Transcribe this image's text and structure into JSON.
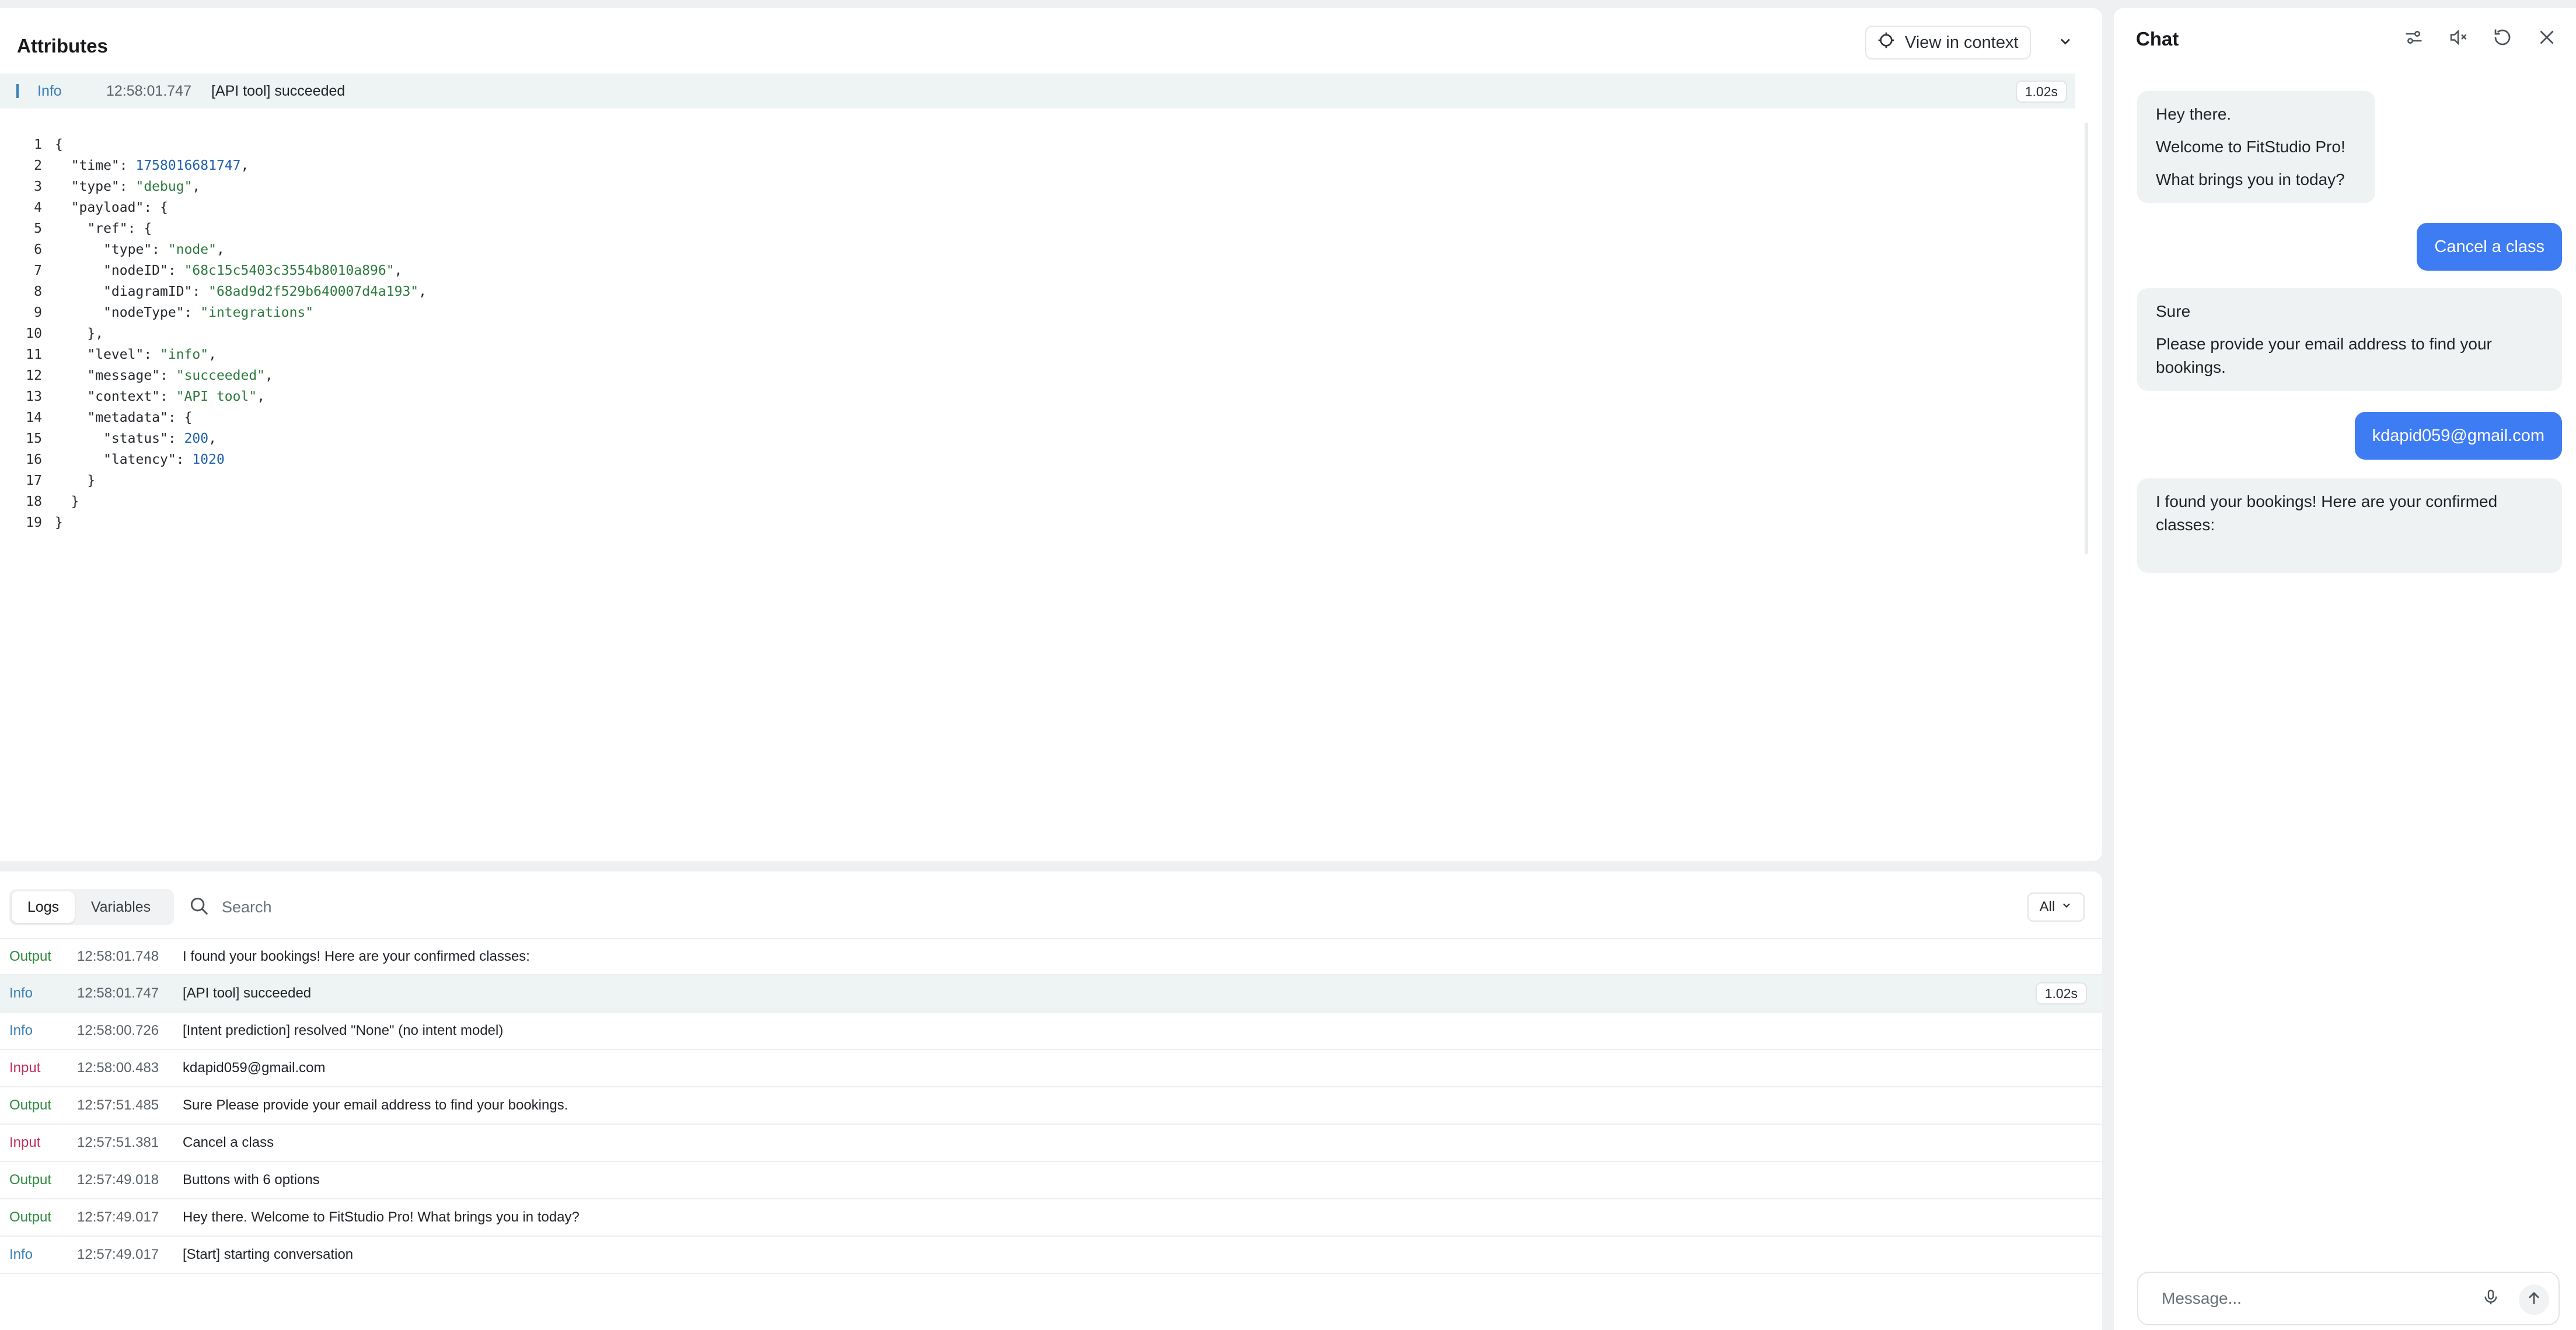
{
  "attributes": {
    "title": "Attributes",
    "view_in_context_label": "View in context",
    "selected_log": {
      "level": "Info",
      "timestamp": "12:58:01.747",
      "message": "[API tool] succeeded",
      "duration": "1.02s"
    },
    "code_lines": [
      {
        "n": "1",
        "t": "{"
      },
      {
        "n": "2",
        "t": "  \"time\": 1758016681747,"
      },
      {
        "n": "3",
        "t": "  \"type\": \"debug\","
      },
      {
        "n": "4",
        "t": "  \"payload\": {"
      },
      {
        "n": "5",
        "t": "    \"ref\": {"
      },
      {
        "n": "6",
        "t": "      \"type\": \"node\","
      },
      {
        "n": "7",
        "t": "      \"nodeID\": \"68c15c5403c3554b8010a896\","
      },
      {
        "n": "8",
        "t": "      \"diagramID\": \"68ad9d2f529b640007d4a193\","
      },
      {
        "n": "9",
        "t": "      \"nodeType\": \"integrations\""
      },
      {
        "n": "10",
        "t": "    },"
      },
      {
        "n": "11",
        "t": "    \"level\": \"info\","
      },
      {
        "n": "12",
        "t": "    \"message\": \"succeeded\","
      },
      {
        "n": "13",
        "t": "    \"context\": \"API tool\","
      },
      {
        "n": "14",
        "t": "    \"metadata\": {"
      },
      {
        "n": "15",
        "t": "      \"status\": 200,"
      },
      {
        "n": "16",
        "t": "      \"latency\": 1020"
      },
      {
        "n": "17",
        "t": "    }"
      },
      {
        "n": "18",
        "t": "  }"
      },
      {
        "n": "19",
        "t": "}"
      }
    ]
  },
  "logs": {
    "tabs": [
      {
        "label": "Logs",
        "active": true
      },
      {
        "label": "Variables",
        "active": false
      }
    ],
    "search_placeholder": "Search",
    "filter_label": "All",
    "rows": [
      {
        "level": "Output",
        "timestamp": "12:58:01.748",
        "message": "I found your bookings! Here are your confirmed classes:",
        "duration": "",
        "selected": false
      },
      {
        "level": "Info",
        "timestamp": "12:58:01.747",
        "message": "[API tool] succeeded",
        "duration": "1.02s",
        "selected": true
      },
      {
        "level": "Info",
        "timestamp": "12:58:00.726",
        "message": "[Intent prediction] resolved \"None\" (no intent model)",
        "duration": "",
        "selected": false
      },
      {
        "level": "Input",
        "timestamp": "12:58:00.483",
        "message": "kdapid059@gmail.com",
        "duration": "",
        "selected": false
      },
      {
        "level": "Output",
        "timestamp": "12:57:51.485",
        "message": "Sure Please provide your email address to find your bookings.",
        "duration": "",
        "selected": false
      },
      {
        "level": "Input",
        "timestamp": "12:57:51.381",
        "message": "Cancel a class",
        "duration": "",
        "selected": false
      },
      {
        "level": "Output",
        "timestamp": "12:57:49.018",
        "message": "Buttons with 6 options",
        "duration": "",
        "selected": false
      },
      {
        "level": "Output",
        "timestamp": "12:57:49.017",
        "message": "Hey there. Welcome to FitStudio Pro! What brings you in today?",
        "duration": "",
        "selected": false
      },
      {
        "level": "Info",
        "timestamp": "12:57:49.017",
        "message": "[Start] starting conversation",
        "duration": "",
        "selected": false
      }
    ]
  },
  "chat": {
    "title": "Chat",
    "icons": [
      "settings-sliders-icon",
      "mute-icon",
      "restart-icon",
      "close-icon"
    ],
    "messages": [
      {
        "from": "bot",
        "lines": [
          "Hey there.",
          "Welcome to FitStudio Pro!",
          "What brings you in today?"
        ]
      },
      {
        "from": "user",
        "text": "Cancel a class"
      },
      {
        "from": "bot",
        "lines": [
          "Sure",
          "Please provide your email address to find your bookings."
        ]
      },
      {
        "from": "user",
        "text": "kdapid059@gmail.com"
      },
      {
        "from": "bot",
        "lines": [
          "I found your bookings! Here are your confirmed classes:"
        ]
      }
    ],
    "input_placeholder": "Message..."
  },
  "colors": {
    "accent_blue": "#3e7cf4",
    "info": "#3a7fb5",
    "output": "#2f8a3e",
    "input": "#c0305a"
  }
}
